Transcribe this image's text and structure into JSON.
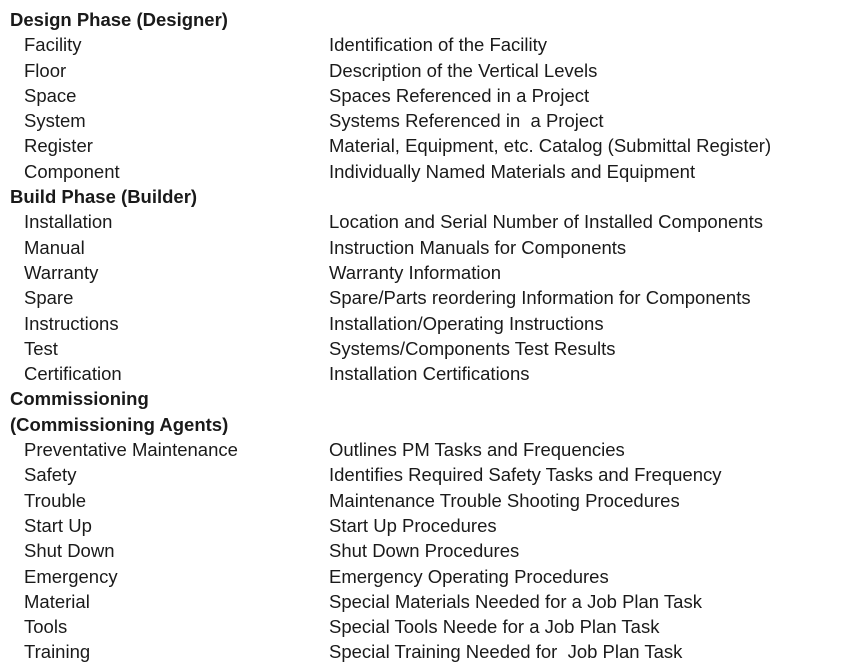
{
  "sections": [
    {
      "heading_lines": [
        "Design Phase (Designer)"
      ],
      "items": [
        {
          "name": "Facility",
          "description": "Identification of the Facility"
        },
        {
          "name": "Floor",
          "description": "Description of the Vertical Levels"
        },
        {
          "name": "Space",
          "description": "Spaces Referenced in a Project"
        },
        {
          "name": "System",
          "description": "Systems Referenced in  a Project"
        },
        {
          "name": "Register",
          "description": "Material, Equipment, etc. Catalog (Submittal Register)"
        },
        {
          "name": "Component",
          "description": "Individually Named Materials and Equipment"
        }
      ]
    },
    {
      "heading_lines": [
        "Build Phase (Builder)"
      ],
      "items": [
        {
          "name": "Installation",
          "description": "Location and Serial Number of Installed Components"
        },
        {
          "name": "Manual",
          "description": "Instruction Manuals for Components"
        },
        {
          "name": "Warranty",
          "description": "Warranty Information"
        },
        {
          "name": "Spare",
          "description": "Spare/Parts reordering Information for Components"
        },
        {
          "name": "Instructions",
          "description": "Installation/Operating Instructions"
        },
        {
          "name": "Test",
          "description": "Systems/Components Test Results"
        },
        {
          "name": "Certification",
          "description": "Installation Certifications"
        }
      ]
    },
    {
      "heading_lines": [
        "Commissioning",
        "(Commissioning Agents)"
      ],
      "items": [
        {
          "name": "Preventative Maintenance",
          "description": "Outlines PM Tasks and Frequencies"
        },
        {
          "name": "Safety",
          "description": "Identifies Required Safety Tasks and Frequency"
        },
        {
          "name": "Trouble",
          "description": "Maintenance Trouble Shooting Procedures"
        },
        {
          "name": "Start Up",
          "description": "Start Up Procedures"
        },
        {
          "name": "Shut Down",
          "description": "Shut Down Procedures"
        },
        {
          "name": "Emergency",
          "description": "Emergency Operating Procedures"
        },
        {
          "name": "Material",
          "description": "Special Materials Needed for a Job Plan Task"
        },
        {
          "name": "Tools",
          "description": "Special Tools Neede for a Job Plan Task"
        },
        {
          "name": "Training",
          "description": "Special Training Needed for  Job Plan Task"
        }
      ]
    }
  ]
}
